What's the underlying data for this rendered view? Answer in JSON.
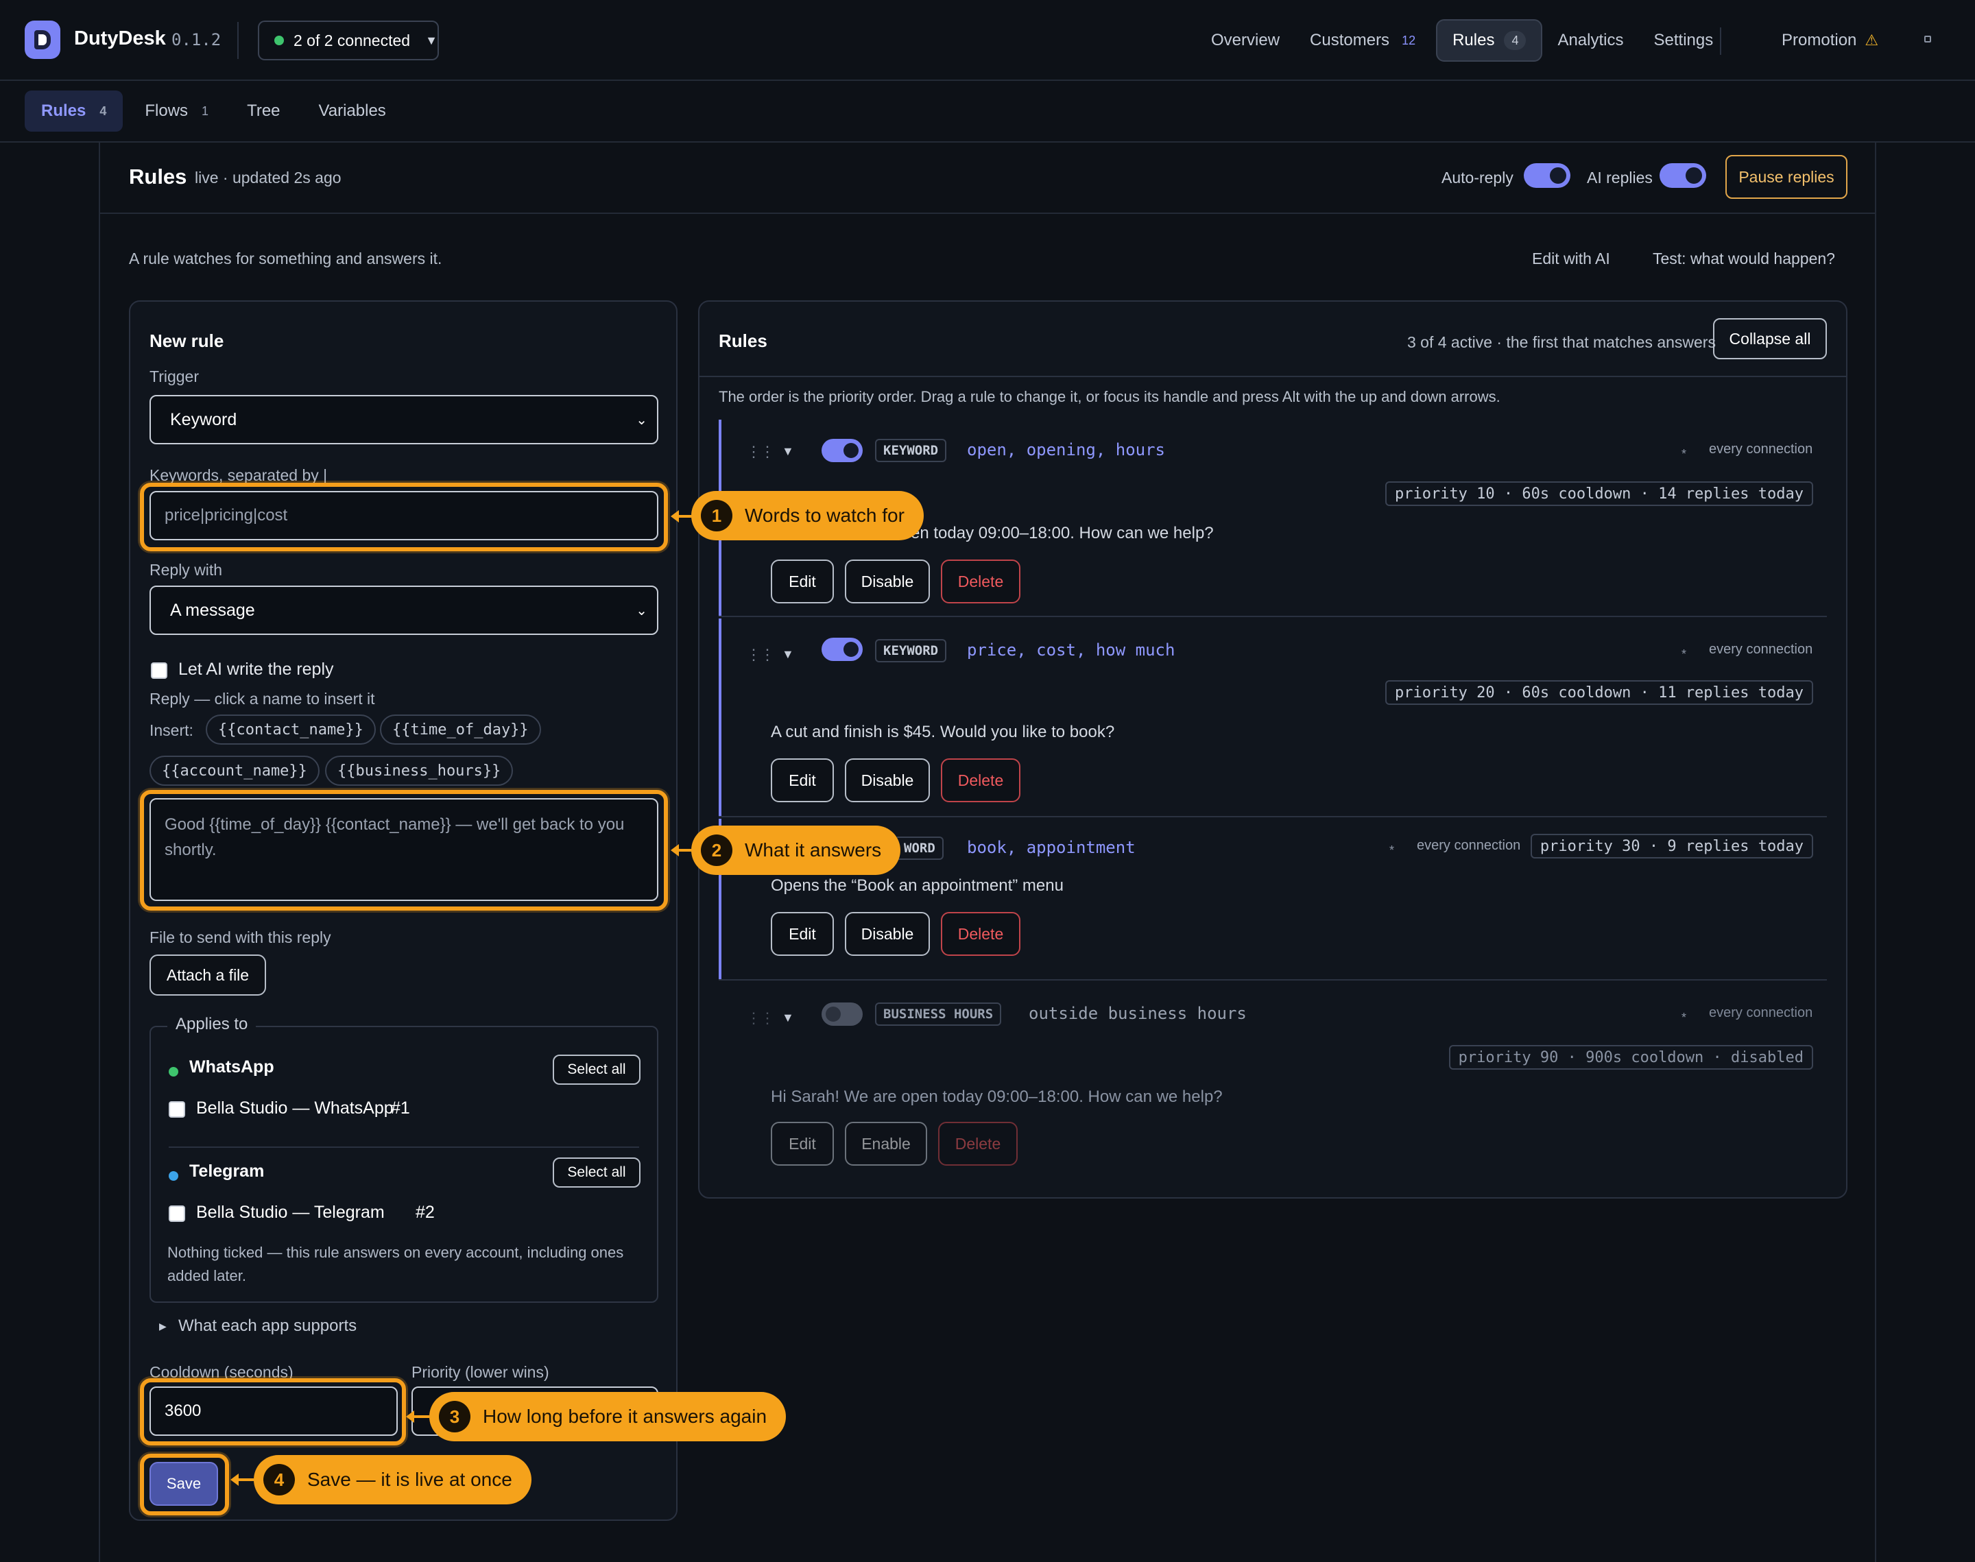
{
  "app": {
    "name": "DutyDesk",
    "version": "0.1.2",
    "connection": "2 of 2 connected"
  },
  "topnav": [
    {
      "label": "Overview",
      "count": ""
    },
    {
      "label": "Customers",
      "count": "12"
    },
    {
      "label": "Rules",
      "count": "4",
      "active": true
    },
    {
      "label": "Analytics",
      "count": ""
    },
    {
      "label": "Settings",
      "count": ""
    },
    {
      "label": "Promotion",
      "count": ""
    }
  ],
  "subnav": [
    {
      "label": "Rules",
      "count": "4",
      "active": true
    },
    {
      "label": "Flows",
      "count": "1"
    },
    {
      "label": "Tree",
      "count": ""
    },
    {
      "label": "Variables",
      "count": ""
    }
  ],
  "page": {
    "title": "Rules",
    "status": "live · updated 2s ago",
    "autoreply_label": "Auto-reply",
    "aireplies_label": "AI replies",
    "pause_label": "Pause replies",
    "description": "A rule watches for something and answers it.",
    "edit_ai": "Edit with AI",
    "test_link": "Test: what would happen?"
  },
  "newrule": {
    "title": "New rule",
    "trigger_label": "Trigger",
    "trigger_value": "Keyword",
    "keywords_label": "Keywords, separated by |",
    "keywords_placeholder": "price|pricing|cost",
    "replywith_label": "Reply with",
    "replywith_value": "A message",
    "ai_write_label": "Let AI write the reply",
    "reply_hint": "Reply — click a name to insert it",
    "insert_label": "Insert:",
    "chips": [
      "{{contact_name}}",
      "{{time_of_day}}",
      "{{account_name}}",
      "{{business_hours}}"
    ],
    "reply_placeholder": "Good {{time_of_day}} {{contact_name}} — we'll get back to you shortly.",
    "file_label": "File to send with this reply",
    "attach_label": "Attach a file",
    "applies_label": "Applies to",
    "groups": [
      {
        "name": "WhatsApp",
        "select_all": "Select all",
        "account": "Bella Studio — WhatsApp",
        "num": "#1",
        "color": "#3ec46d"
      },
      {
        "name": "Telegram",
        "select_all": "Select all",
        "account": "Bella Studio — Telegram",
        "num": "#2",
        "color": "#3ca3e8"
      }
    ],
    "nothing_note": "Nothing ticked — this rule answers on every account, including ones added later.",
    "app_support": "What each app supports",
    "cooldown_label": "Cooldown (seconds)",
    "cooldown_value": "3600",
    "priority_label": "Priority (lower wins)",
    "save_label": "Save"
  },
  "callouts": [
    {
      "n": "1",
      "text": "Words to watch for"
    },
    {
      "n": "2",
      "text": "What it answers"
    },
    {
      "n": "3",
      "text": "How long before it answers again"
    },
    {
      "n": "4",
      "text": "Save — it is live at once"
    }
  ],
  "rules": {
    "title": "Rules",
    "meta": "3 of 4 active · the first that matches answers",
    "collapse": "Collapse all",
    "note": "The order is the priority order. Drag a rule to change it, or focus its handle and press Alt with the up and down arrows.",
    "items": [
      {
        "type": "KEYWORD",
        "terms": "open, opening, hours",
        "conn": "every connection",
        "prio": "priority 10 · 60s cooldown · 14 replies today",
        "text": "Hi Sarah! We are open today 09:00–18:00. How can we help?",
        "text_visible": "en today 09:00–18:00. How can we help?",
        "enabled": true,
        "edit": "Edit",
        "toggle": "Disable",
        "delete": "Delete"
      },
      {
        "type": "KEYWORD",
        "terms": "price, cost, how much",
        "conn": "every connection",
        "prio": "priority 20 · 60s cooldown · 11 replies today",
        "text": "A cut and finish is $45. Would you like to book?",
        "enabled": true,
        "edit": "Edit",
        "toggle": "Disable",
        "delete": "Delete"
      },
      {
        "type": "KEYWORD",
        "type_visible": "WORD",
        "terms": "book, appointment",
        "conn": "every connection",
        "prio": "priority 30 · 9 replies today",
        "text": "Opens the “Book an appointment” menu",
        "enabled": true,
        "edit": "Edit",
        "toggle": "Disable",
        "delete": "Delete"
      },
      {
        "type": "BUSINESS HOURS",
        "terms": "outside business hours",
        "conn": "every connection",
        "prio": "priority 90 · 900s cooldown · disabled",
        "text": "Hi Sarah! We are open today 09:00–18:00. How can we help?",
        "enabled": false,
        "edit": "Edit",
        "toggle": "Enable",
        "delete": "Delete"
      }
    ]
  },
  "colors": {
    "accent": "#7b83f5",
    "highlight": "#f59e1b",
    "danger": "#f05a5e",
    "pause": "#e2a64a"
  }
}
